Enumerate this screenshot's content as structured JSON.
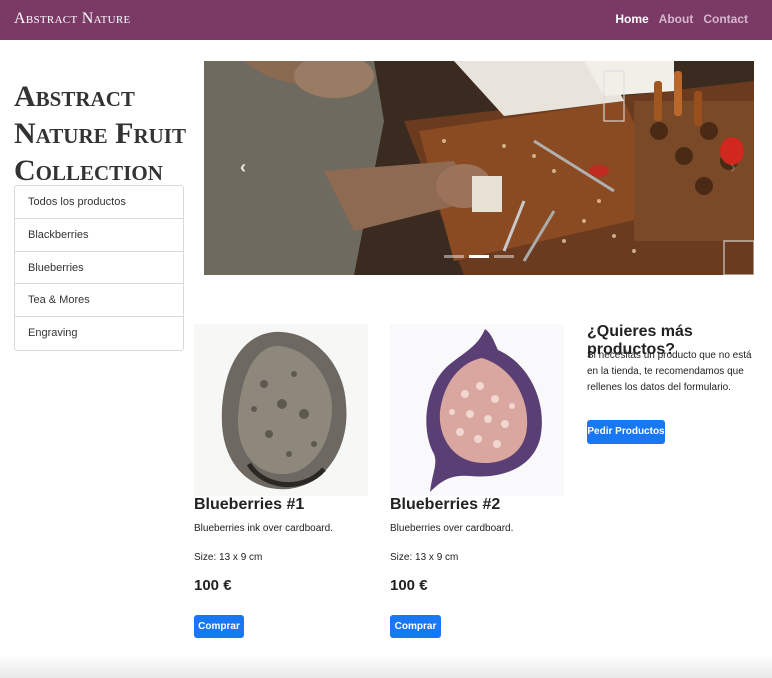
{
  "navbar": {
    "brand": "Abstract Nature",
    "links": [
      {
        "label": "Home"
      },
      {
        "label": "About"
      },
      {
        "label": "Contact"
      }
    ]
  },
  "page_title": "Abstract Nature Fruit Collection",
  "sidebar": {
    "items": [
      {
        "label": "Todos los productos"
      },
      {
        "label": "Blackberries"
      },
      {
        "label": "Blueberries"
      },
      {
        "label": "Tea & Mores"
      },
      {
        "label": "Engraving"
      }
    ]
  },
  "carousel": {
    "prev_icon": "‹",
    "next_icon": "›",
    "slide_count": 3,
    "active_slide": 1
  },
  "products": [
    {
      "name": "Blueberries #1",
      "description": "Blueberries ink over cardboard.",
      "size": "Size: 13 x 9 cm",
      "price": "100 €",
      "button": "Comprar"
    },
    {
      "name": "Blueberries #2",
      "description": "Blueberries over cardboard.",
      "size": "Size: 13 x 9 cm",
      "price": "100 €",
      "button": "Comprar"
    }
  ],
  "promo": {
    "heading": "¿Quieres más productos?",
    "text": "Si necesitas un producto que no está en la tienda, te recomendamos que rellenes los datos del formulario.",
    "button": "Pedir Productos"
  },
  "colors": {
    "navbar": "#7b3a66",
    "primary_button": "#1877f2"
  }
}
